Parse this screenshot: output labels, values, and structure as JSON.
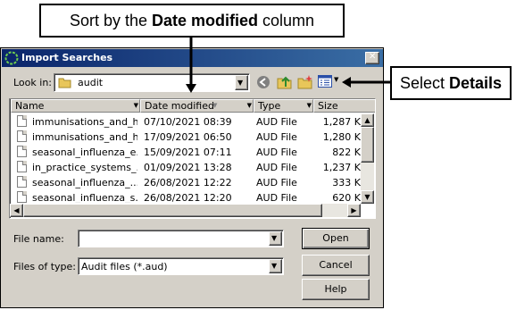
{
  "callouts": {
    "sort": {
      "prefix": "Sort by the ",
      "bold": "Date modified",
      "suffix": " column"
    },
    "details": {
      "prefix": "Select ",
      "bold": "Details"
    }
  },
  "dialog": {
    "title": "Import Searches",
    "close_glyph": "✕",
    "look_in_label": "Look in:",
    "look_in_value": "audit",
    "columns": [
      "Name",
      "Date modified",
      "Type",
      "Size"
    ],
    "files": [
      {
        "name": "immunisations_and_h...",
        "date": "07/10/2021 08:39",
        "type": "AUD File",
        "size": "1,287 K"
      },
      {
        "name": "immunisations_and_h...",
        "date": "17/09/2021 06:50",
        "type": "AUD File",
        "size": "1,280 K"
      },
      {
        "name": "seasonal_influenza_e...",
        "date": "15/09/2021 07:11",
        "type": "AUD File",
        "size": "822 K"
      },
      {
        "name": "in_practice_systems_...",
        "date": "01/09/2021 13:28",
        "type": "AUD File",
        "size": "1,237 K"
      },
      {
        "name": "seasonal_influenza_...",
        "date": "26/08/2021 12:22",
        "type": "AUD File",
        "size": "333 K"
      },
      {
        "name": "seasonal_influenza_s...",
        "date": "26/08/2021 12:20",
        "type": "AUD File",
        "size": "620 K"
      }
    ],
    "file_name_label": "File name:",
    "file_name_value": "",
    "file_type_label": "Files of type:",
    "file_type_value": "Audit files (*.aud)",
    "buttons": {
      "open": "Open",
      "cancel": "Cancel",
      "help": "Help"
    }
  }
}
